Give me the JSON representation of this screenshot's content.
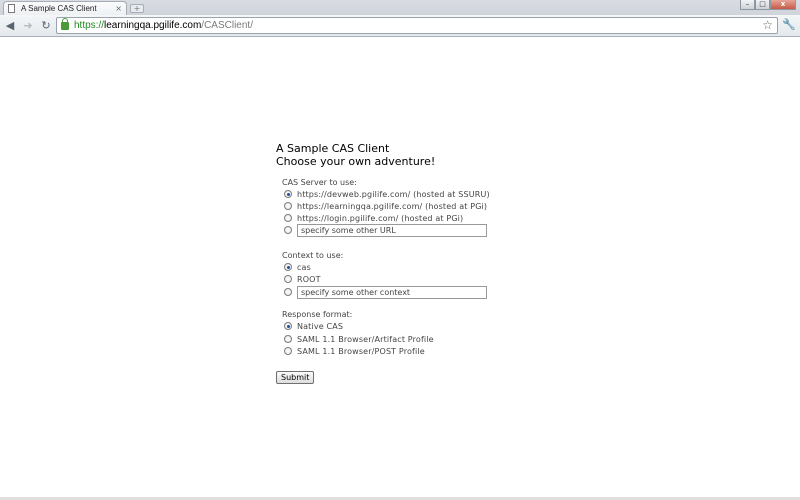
{
  "browser": {
    "tab_title": "A Sample CAS Client",
    "tab_close": "×",
    "new_tab": "+",
    "window_controls": {
      "minimize": "–",
      "maximize": "□",
      "close": "x"
    },
    "url": {
      "scheme": "https://",
      "host": "learningqa.pgilife.com",
      "path": "/CASClient/"
    },
    "icons": [
      "back-icon",
      "forward-icon",
      "reload-icon",
      "lock-icon",
      "star-icon",
      "wrench-icon"
    ]
  },
  "page": {
    "title_line1": "A Sample CAS Client",
    "title_line2": "Choose your own adventure!",
    "cas_server": {
      "label": "CAS Server to use:",
      "options": [
        "https://devweb.pgilife.com/ (hosted at SSURU)",
        "https://learningqa.pgilife.com/ (hosted at PGi)",
        "https://login.pgilife.com/ (hosted at PGi)"
      ],
      "selected_index": 0,
      "other_placeholder": "specify some other URL"
    },
    "context": {
      "label": "Context to use:",
      "options": [
        "cas",
        "ROOT"
      ],
      "selected_index": 0,
      "other_placeholder": "specify some other context"
    },
    "response_format": {
      "label": "Response format:",
      "options": [
        "Native CAS",
        "SAML 1.1 Browser/Artifact Profile",
        "SAML 1.1 Browser/POST Profile"
      ],
      "selected_index": 0
    },
    "submit_label": "Submit"
  }
}
